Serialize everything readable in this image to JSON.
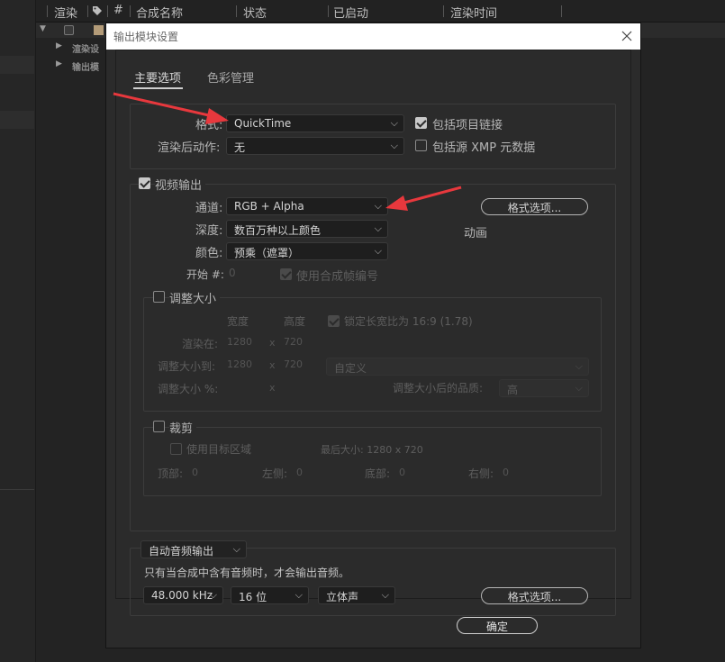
{
  "queue": {
    "columns": [
      "渲染",
      "#",
      "合成名称",
      "状态",
      "已启动",
      "渲染时间"
    ],
    "sub_items": [
      "渲染设",
      "输出模"
    ]
  },
  "dialog": {
    "title": "输出模块设置",
    "tabs": [
      "主要选项",
      "色彩管理"
    ],
    "format": {
      "label": "格式:",
      "value": "QuickTime",
      "include_project_link": "包括项目链接",
      "post_render_label": "渲染后动作:",
      "post_render_value": "无",
      "include_xmp": "包括源 XMP 元数据"
    },
    "video": {
      "title": "视频输出",
      "channels_label": "通道:",
      "channels_value": "RGB + Alpha",
      "format_options": "格式选项...",
      "codec_text": "动画",
      "depth_label": "深度:",
      "depth_value": "数百万种以上颜色",
      "color_label": "颜色:",
      "color_value": "预乘（遮罩）",
      "start_label": "开始 #:",
      "start_value": "0",
      "use_comp_frame": "使用合成帧编号"
    },
    "resize": {
      "title": "调整大小",
      "width_header": "宽度",
      "height_header": "高度",
      "lock_aspect": "锁定长宽比为 16:9 (1.78)",
      "render_at_label": "渲染在:",
      "render_w": "1280",
      "render_h": "720",
      "resize_to_label": "调整大小到:",
      "resize_w": "1280",
      "resize_h": "720",
      "resize_to_value": "自定义",
      "resize_pct_label": "调整大小 %:",
      "x": "x",
      "quality_label": "调整大小后的品质:",
      "quality_value": "高"
    },
    "crop": {
      "title": "裁剪",
      "use_roi": "使用目标区域",
      "final_size": "最后大小: 1280 x 720",
      "top_label": "顶部:",
      "top_value": "0",
      "left_label": "左侧:",
      "left_value": "0",
      "bottom_label": "底部:",
      "bottom_value": "0",
      "right_label": "右侧:",
      "right_value": "0"
    },
    "audio": {
      "mode_value": "自动音频输出",
      "note": "只有当合成中含有音频时，才会输出音频。",
      "rate_value": "48.000 kHz",
      "bits_value": "16 位",
      "channels_value": "立体声",
      "format_options": "格式选项..."
    },
    "ok_label": "确定"
  },
  "colors": {
    "arrow": "#e8383d",
    "dialog_bg": "#2b2b2b",
    "field_bg": "#1e1e1e"
  }
}
